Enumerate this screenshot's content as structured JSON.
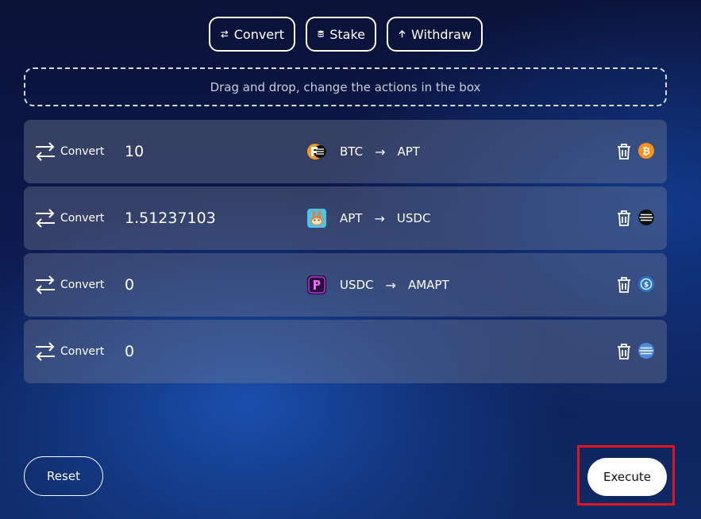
{
  "toolbar": {
    "convert_label": "Convert",
    "stake_label": "Stake",
    "withdraw_label": "Withdraw"
  },
  "dropzone": {
    "text": "Drag and drop, change the actions in the box"
  },
  "rows": [
    {
      "action": "Convert",
      "amount": "10",
      "from": "BTC",
      "to": "APT",
      "pair_logo": "fire-coin-icon",
      "coin": "bitcoin-icon"
    },
    {
      "action": "Convert",
      "amount": "1.51237103",
      "from": "APT",
      "to": "USDC",
      "pair_logo": "pancake-bunny-icon",
      "coin": "aptos-icon"
    },
    {
      "action": "Convert",
      "amount": "0",
      "from": "USDC",
      "to": "AMAPT",
      "pair_logo": "amnis-logo-icon",
      "coin": "usdc-icon"
    },
    {
      "action": "Convert",
      "amount": "0",
      "from": "",
      "to": "",
      "pair_logo": "",
      "coin": "amapt-icon"
    }
  ],
  "arrow": "→",
  "footer": {
    "reset_label": "Reset",
    "execute_label": "Execute"
  },
  "colors": {
    "highlight": "#e0161c",
    "bitcoin": "#f7931a",
    "usdc": "#2775ca"
  }
}
